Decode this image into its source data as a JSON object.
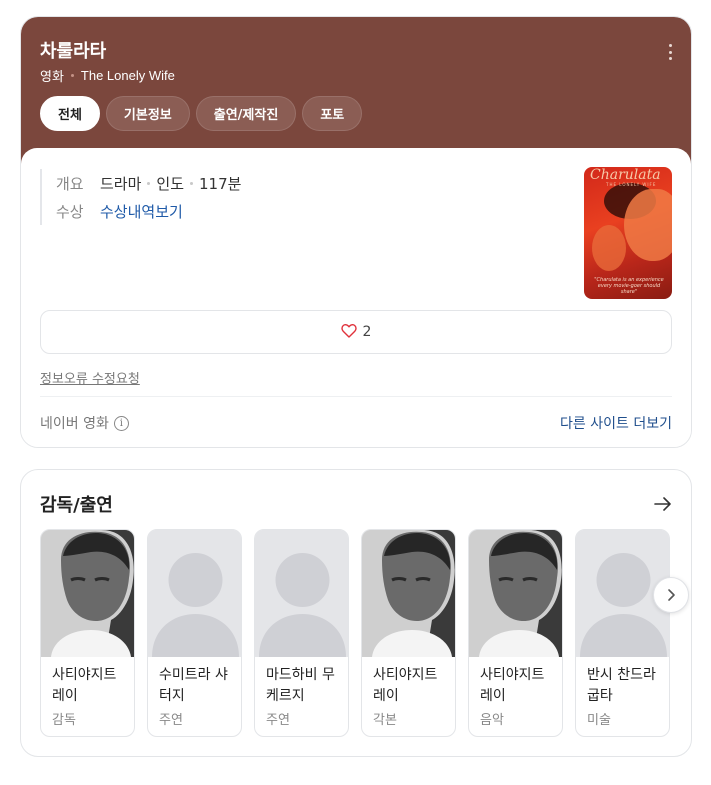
{
  "header": {
    "title": "차룰라타",
    "category": "영화",
    "original_title": "The Lonely Wife",
    "bg_color": "#7b473d"
  },
  "tabs": [
    {
      "label": "전체",
      "active": true
    },
    {
      "label": "기본정보",
      "active": false
    },
    {
      "label": "출연/제작진",
      "active": false
    },
    {
      "label": "포토",
      "active": false
    }
  ],
  "overview": {
    "key": "개요",
    "genre": "드라마",
    "country": "인도",
    "runtime": "117분"
  },
  "awards": {
    "key": "수상",
    "link": "수상내역보기"
  },
  "poster": {
    "title": "Charulata",
    "subtitle": "THE LONELY WIFE",
    "caption": "\"Charulata is an experience every movie-goer should share\""
  },
  "like": {
    "icon": "heart-outline-icon",
    "count": "2"
  },
  "report_link": "정보오류 수정요청",
  "source": {
    "label": "네이버 영화",
    "icon": "info-icon",
    "icon_glyph": "i"
  },
  "more_sites": "다른 사이트 더보기",
  "cast_section": {
    "title": "감독/출연",
    "arrow_icon": "arrow-right-icon",
    "people": [
      {
        "name": "사티야지트 레이",
        "role": "감독",
        "photo": "portrait"
      },
      {
        "name": "수미트라 샤터지",
        "role": "주연",
        "photo": "placeholder"
      },
      {
        "name": "마드하비 무케르지",
        "role": "주연",
        "photo": "placeholder"
      },
      {
        "name": "사티야지트 레이",
        "role": "각본",
        "photo": "portrait"
      },
      {
        "name": "사티야지트 레이",
        "role": "음악",
        "photo": "portrait"
      },
      {
        "name": "반시 찬드라굽타",
        "role": "미술",
        "photo": "placeholder"
      }
    ],
    "next_icon": "chevron-right-icon"
  }
}
